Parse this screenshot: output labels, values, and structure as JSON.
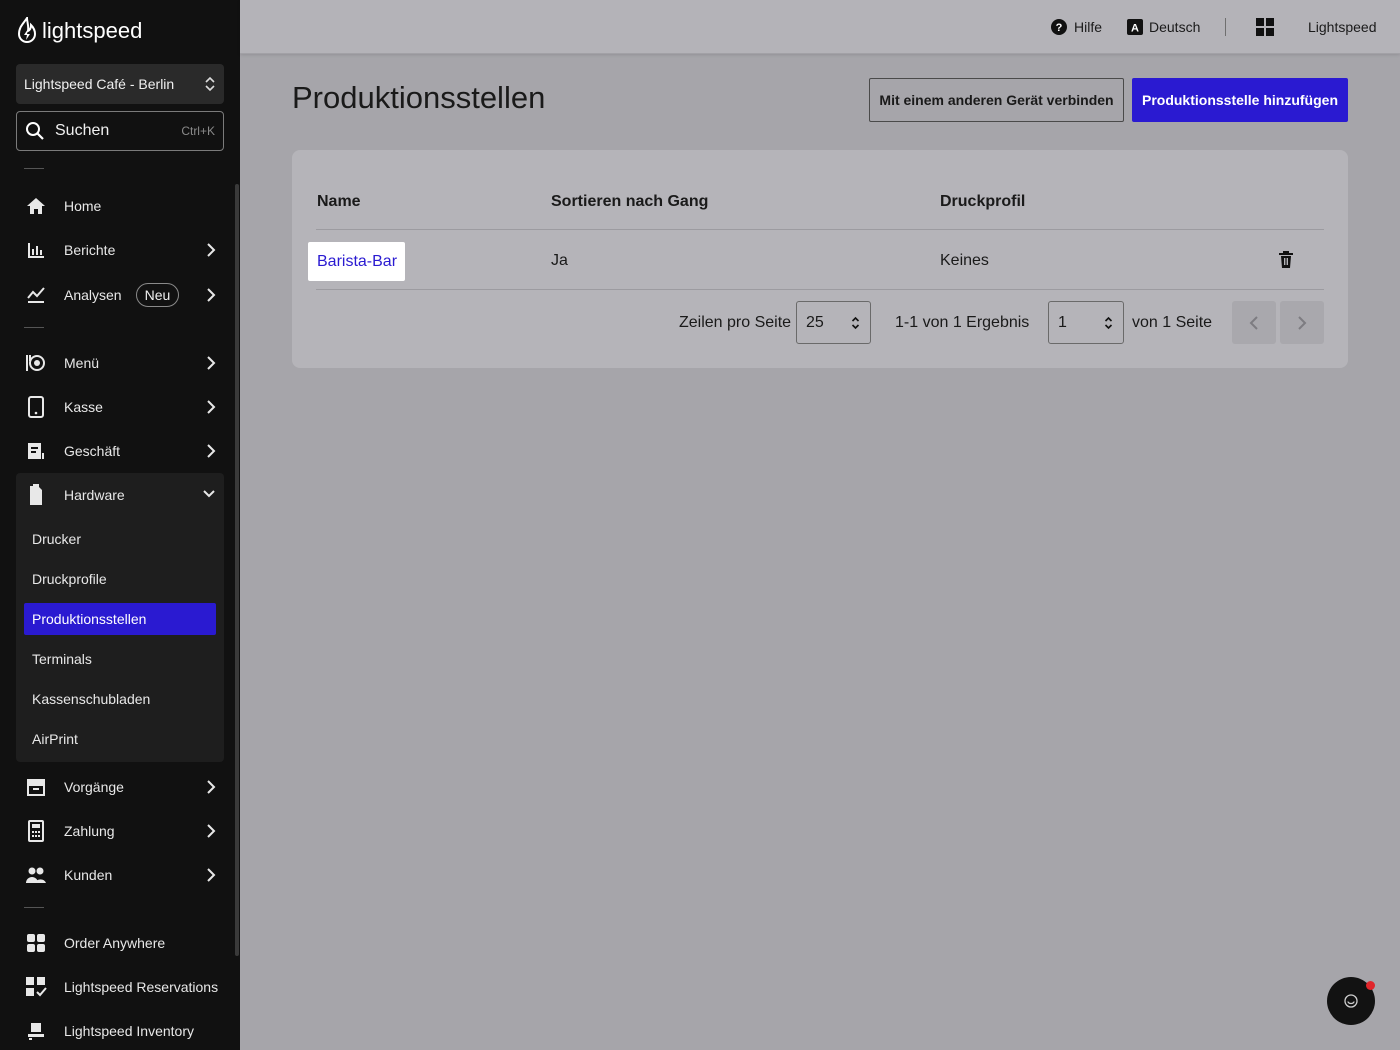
{
  "app": {
    "logo_text": "lightspeed"
  },
  "sidebar": {
    "location": "Lightspeed Café - Berlin",
    "search": {
      "label": "Suchen",
      "shortcut": "Ctrl+K"
    },
    "nav": {
      "home": "Home",
      "berichte": "Berichte",
      "analysen": "Analysen",
      "analysen_badge": "Neu",
      "menu": "Menü",
      "kasse": "Kasse",
      "geschaeft": "Geschäft",
      "hardware": "Hardware",
      "vorgaenge": "Vorgänge",
      "zahlung": "Zahlung",
      "kunden": "Kunden",
      "order_anywhere": "Order Anywhere",
      "reservations": "Lightspeed Reservations",
      "inventory": "Lightspeed Inventory"
    },
    "hardware_items": [
      "Drucker",
      "Druckprofile",
      "Produktionsstellen",
      "Terminals",
      "Kassenschubladen",
      "AirPrint"
    ],
    "active_item": "Produktionsstellen"
  },
  "topbar": {
    "help": "Hilfe",
    "language": "Deutsch",
    "account": "Lightspeed"
  },
  "main": {
    "title": "Produktionsstellen",
    "connect_button": "Mit einem anderen Gerät verbinden",
    "add_button": "Produktionsstelle hinzufügen",
    "table": {
      "columns": [
        "Name",
        "Sortieren nach Gang",
        "Druckprofil"
      ],
      "rows": [
        {
          "name": "Barista-Bar",
          "sort_by_course": "Ja",
          "print_profile": "Keines"
        }
      ]
    },
    "pagination": {
      "rows_per_page_label": "Zeilen pro Seite",
      "rows_per_page": "25",
      "results": "1-1 von 1 Ergebnis",
      "page": "1",
      "of_pages": "von 1 Seite"
    }
  },
  "colors": {
    "accent": "#2a1ad1",
    "sidebar_bg": "#111111",
    "notification": "#e0262b"
  }
}
